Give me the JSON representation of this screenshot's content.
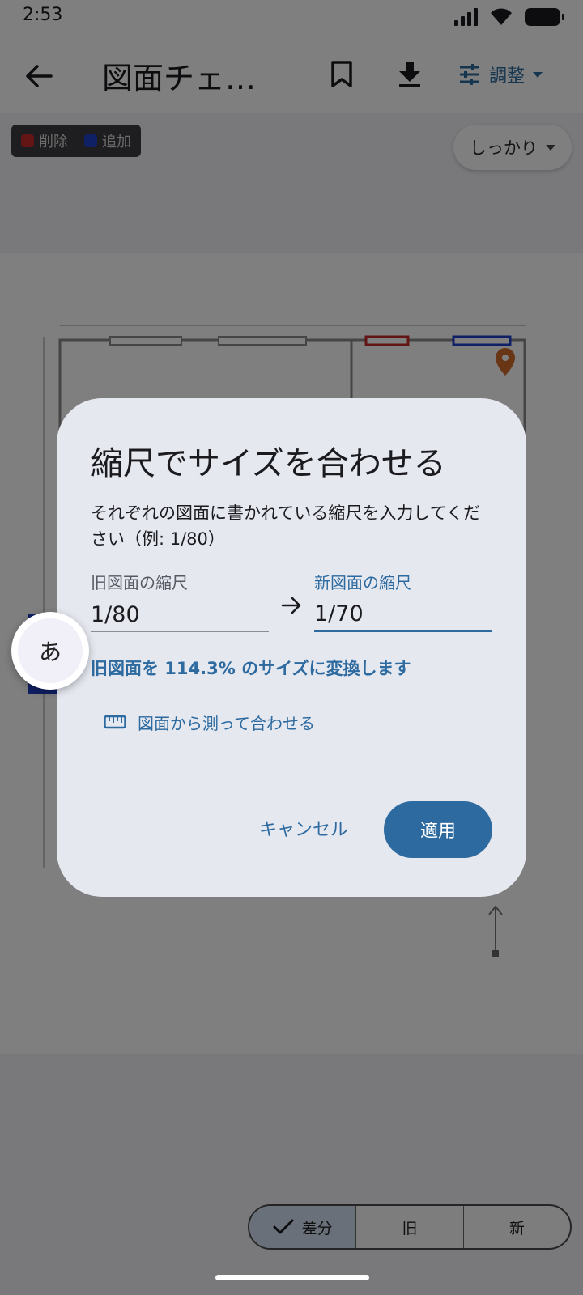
{
  "status_bar": {
    "time": "2:53"
  },
  "app_bar": {
    "title": "図面チェ…",
    "adjust_label": "調整"
  },
  "legend": {
    "delete_label": "削除",
    "delete_color": "#c62828",
    "add_label": "追加",
    "add_color": "#1e40c8"
  },
  "strength": {
    "label": "しっかり"
  },
  "view_toggle": {
    "diff_label": "差分",
    "old_label": "旧",
    "new_label": "新",
    "selected": "差分"
  },
  "dialog": {
    "title": "縮尺でサイズを合わせる",
    "description": "それぞれの図面に書かれている縮尺を入力してください（例: 1/80）",
    "old_scale_label": "旧図面の縮尺",
    "old_scale_value": "1/80",
    "new_scale_label": "新図面の縮尺",
    "new_scale_value": "1/70",
    "convert_text": "旧図面を 114.3% のサイズに変換します",
    "measure_label": "図面から測って合わせる",
    "cancel_label": "キャンセル",
    "apply_label": "適用"
  },
  "ime": {
    "label": "あ"
  },
  "colors": {
    "accent": "#2d6a9f",
    "dialog_bg": "#e6e8f0"
  }
}
